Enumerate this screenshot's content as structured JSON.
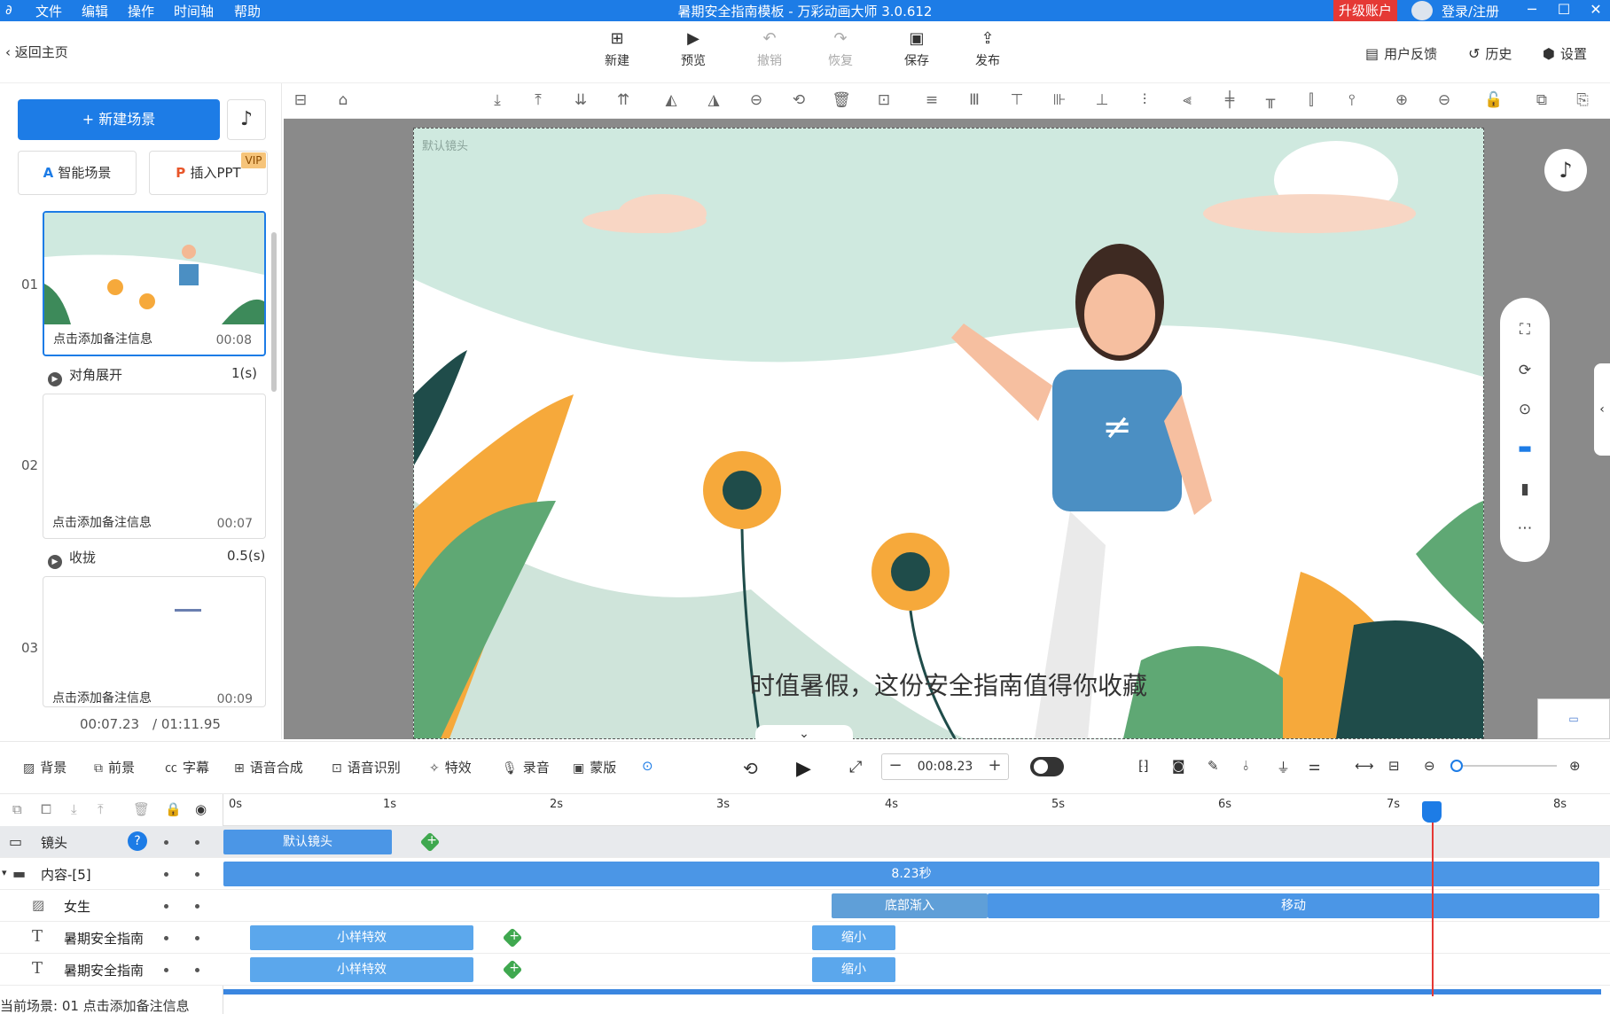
{
  "app": {
    "title": "暑期安全指南模板 - 万彩动画大师 3.0.612",
    "menu": [
      "文件",
      "编辑",
      "操作",
      "时间轴",
      "帮助"
    ],
    "upgrade": "升级账户",
    "login": "登录/注册"
  },
  "toolbar": {
    "back": "返回主页",
    "new": "新建",
    "preview": "预览",
    "undo": "撤销",
    "redo": "恢复",
    "save": "保存",
    "publish": "发布",
    "feedback": "用户反馈",
    "history": "历史",
    "settings": "设置"
  },
  "left": {
    "new_scene": "新建场景",
    "smart_scene": "智能场景",
    "insert_ppt": "插入PPT",
    "vip": "VIP",
    "scenes": [
      {
        "num": "01",
        "note": "点击添加备注信息",
        "dur": "00:08"
      },
      {
        "num": "02",
        "note": "点击添加备注信息",
        "dur": "00:07"
      },
      {
        "num": "03",
        "note": "点击添加备注信息",
        "dur": "00:09"
      }
    ],
    "transitions": [
      {
        "name": "对角展开",
        "dur": "1(s)"
      },
      {
        "name": "收拢",
        "dur": "0.5(s)"
      }
    ],
    "current_time": "00:07.23",
    "total_time": "/ 01:11.95"
  },
  "canvas": {
    "camera_label": "默认镜头",
    "subtitle": "时值暑假，这份安全指南值得你收藏"
  },
  "bottom_tools": {
    "background": "背景",
    "foreground": "前景",
    "caption": "字幕",
    "tts": "语音合成",
    "asr": "语音识别",
    "effects": "特效",
    "record": "录音",
    "mask": "蒙版",
    "time": "00:08.23"
  },
  "timeline": {
    "ticks": [
      "0s",
      "1s",
      "2s",
      "3s",
      "4s",
      "5s",
      "6s",
      "7s",
      "8s"
    ],
    "tracks": {
      "camera": {
        "name": "镜头",
        "clip": "默认镜头"
      },
      "content": {
        "name": "内容-[5]",
        "clip": "8.23秒"
      },
      "girl": {
        "name": "女生",
        "clip1": "底部渐入",
        "clip2": "移动"
      },
      "text1": {
        "name": "暑期安全指南",
        "clip1": "小样特效",
        "clip2": "缩小"
      },
      "text2": {
        "name": "暑期安全指南",
        "clip1": "小样特效",
        "clip2": "缩小"
      }
    },
    "status": "当前场景: 01   点击添加备注信息"
  }
}
